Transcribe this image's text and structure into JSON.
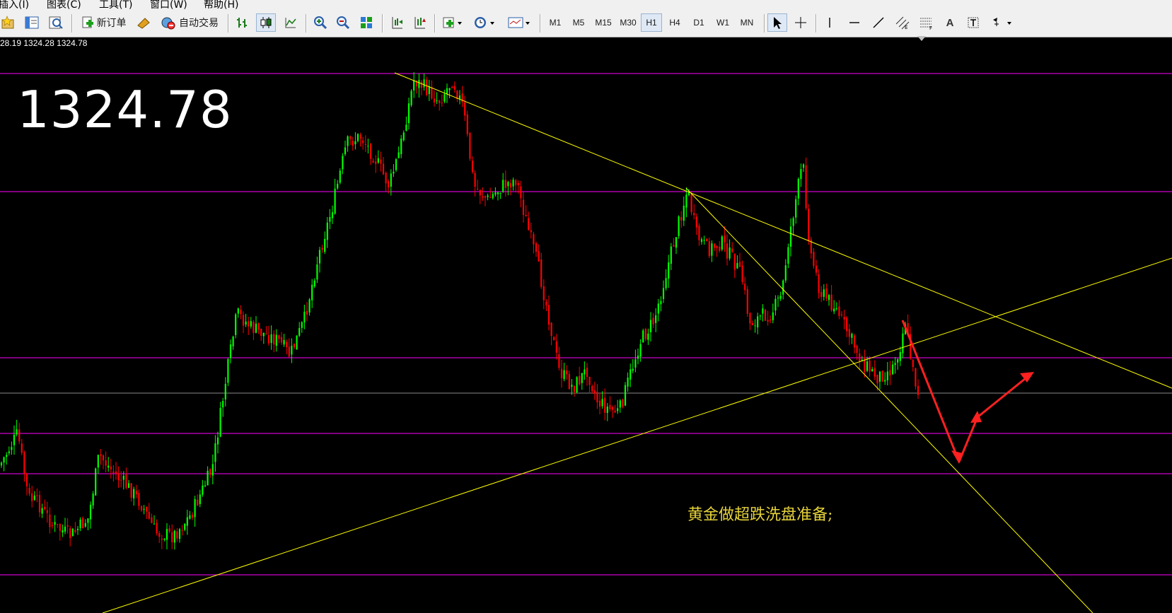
{
  "menu": {
    "items": [
      "插入(I)",
      "图表(C)",
      "工具(T)",
      "窗口(W)",
      "帮助(H)"
    ]
  },
  "toolbar": {
    "new_order_label": "新订单",
    "auto_trade_label": "自动交易",
    "timeframes": [
      "M1",
      "M5",
      "M15",
      "M30",
      "H1",
      "H4",
      "D1",
      "W1",
      "MN"
    ],
    "active_timeframe": "H1"
  },
  "chart": {
    "ohlc_text": "28.19 1324.28 1324.78",
    "big_price": "1324.78",
    "annotation": "黄金做超跌洗盘准备;",
    "colors": {
      "background": "#000000",
      "bull_candle": "#00ff00",
      "bear_candle": "#ff0000",
      "trendline": "#ffff00",
      "level_line": "#ff00ff",
      "bid_line": "#8a8a8a",
      "arrow": "#ff0000",
      "annotation_text": "#e6d23a"
    }
  }
}
